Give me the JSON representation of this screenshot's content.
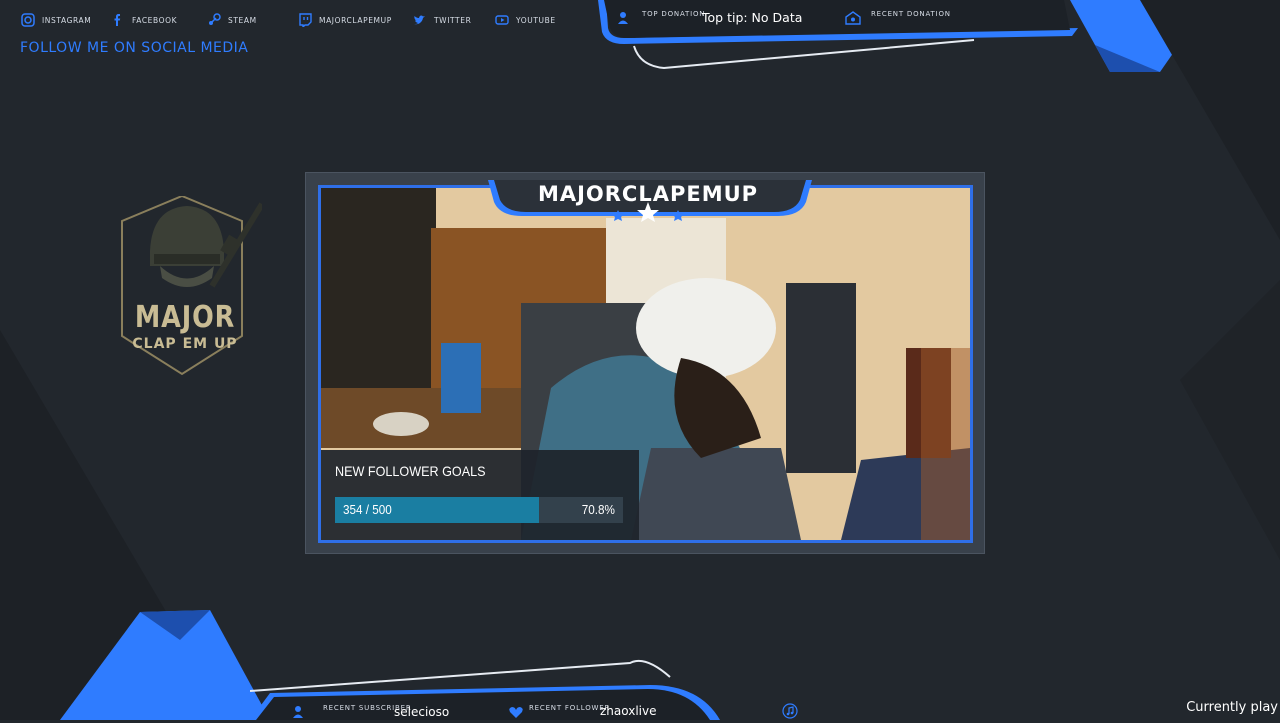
{
  "social": {
    "items": [
      {
        "icon": "instagram-icon",
        "label": "INSTAGRAM"
      },
      {
        "icon": "facebook-icon",
        "label": "FACEBOOK"
      },
      {
        "icon": "steam-icon",
        "label": "STEAM"
      },
      {
        "icon": "twitch-icon",
        "label": "MAJORCLAPEMUP"
      },
      {
        "icon": "twitter-icon",
        "label": "TWITTER"
      },
      {
        "icon": "youtube-icon",
        "label": "YOUTUBE"
      }
    ],
    "follow_text": "FOLLOW ME ON SOCIAL MEDIA"
  },
  "top_panel": {
    "top_donation_label": "TOP DONATION",
    "top_tip": "Top tip: No Data",
    "recent_donation_label": "RECENT DONATION"
  },
  "logo": {
    "line1": "MAJOR",
    "line2": "CLAP EM UP"
  },
  "stream": {
    "title": "MAJORCLAPEMUP"
  },
  "goal": {
    "title": "NEW FOLLOWER GOALS",
    "current": 354,
    "target": 500,
    "count_text": "354 / 500",
    "percent_text": "70.8%",
    "fraction": 0.708
  },
  "bottom_panel": {
    "recent_subscriber_label": "RECENT SUBSCRIBER",
    "recent_subscriber": "selecioso",
    "recent_follower_label": "RECENT FOLLOWER",
    "recent_follower": "zhaoxlive",
    "now_playing": "Currently play"
  },
  "colors": {
    "background": "#22272d",
    "accent": "#2f7cff",
    "goal_fill": "#1a7ea2",
    "logo_gold": "#c9bc94"
  }
}
